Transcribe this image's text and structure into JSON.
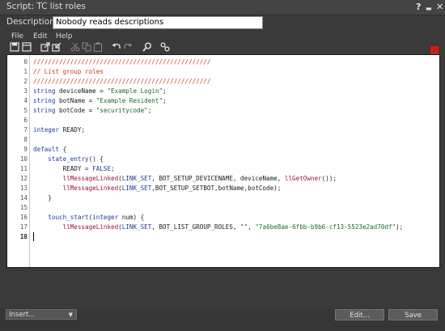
{
  "window": {
    "title": "Script: TC list roles",
    "help_button": "?",
    "minimize_button": "▬",
    "close_button": "✕"
  },
  "description": {
    "label": "Description:",
    "value": "Nobody reads descriptions"
  },
  "menubar": {
    "items": [
      "File",
      "Edit",
      "Help"
    ]
  },
  "toolbar": {
    "icons": [
      "save-icon",
      "save-all-icon",
      "load-icon",
      "save-to-disk-icon",
      "cut-icon",
      "copy-icon",
      "paste-icon",
      "undo-icon",
      "redo-icon",
      "search-icon",
      "settings-icon"
    ],
    "stop_color": "#c0251d"
  },
  "editor": {
    "current_line": "18",
    "lines": [
      {
        "num": "0",
        "segments": [
          {
            "t": "////////////////////////////////////////////////",
            "c": "cmt"
          }
        ]
      },
      {
        "num": "1",
        "segments": [
          {
            "t": "// List group roles",
            "c": "cmt"
          }
        ]
      },
      {
        "num": "2",
        "segments": [
          {
            "t": "////////////////////////////////////////////////",
            "c": "cmt"
          }
        ]
      },
      {
        "num": "3",
        "segments": [
          {
            "t": "string",
            "c": "kw"
          },
          {
            "t": " deviceName = ",
            "c": "txt"
          },
          {
            "t": "\"Example Login\"",
            "c": "str"
          },
          {
            "t": ";",
            "c": "txt"
          }
        ]
      },
      {
        "num": "4",
        "segments": [
          {
            "t": "string",
            "c": "kw"
          },
          {
            "t": " botName = ",
            "c": "txt"
          },
          {
            "t": "\"Example Resident\"",
            "c": "str"
          },
          {
            "t": ";",
            "c": "txt"
          }
        ]
      },
      {
        "num": "5",
        "segments": [
          {
            "t": "string",
            "c": "kw"
          },
          {
            "t": " botCode = ",
            "c": "txt"
          },
          {
            "t": "\"securitycode\"",
            "c": "str"
          },
          {
            "t": ";",
            "c": "txt"
          }
        ]
      },
      {
        "num": "6",
        "segments": []
      },
      {
        "num": "7",
        "segments": [
          {
            "t": "integer",
            "c": "kw"
          },
          {
            "t": " READY;",
            "c": "txt"
          }
        ]
      },
      {
        "num": "8",
        "segments": []
      },
      {
        "num": "9",
        "segments": [
          {
            "t": "default",
            "c": "kw"
          },
          {
            "t": " {",
            "c": "txt"
          }
        ]
      },
      {
        "num": "10",
        "segments": [
          {
            "t": "    ",
            "c": "txt"
          },
          {
            "t": "state_entry",
            "c": "kw"
          },
          {
            "t": "() {",
            "c": "txt"
          }
        ]
      },
      {
        "num": "11",
        "segments": [
          {
            "t": "        READY = ",
            "c": "txt"
          },
          {
            "t": "FALSE",
            "c": "const"
          },
          {
            "t": ";",
            "c": "txt"
          }
        ]
      },
      {
        "num": "12",
        "segments": [
          {
            "t": "        ",
            "c": "txt"
          },
          {
            "t": "llMessageLinked",
            "c": "fn"
          },
          {
            "t": "(",
            "c": "txt"
          },
          {
            "t": "LINK_SET",
            "c": "const"
          },
          {
            "t": ", BOT_SETUP_DEVICENAME, deviceName, ",
            "c": "txt"
          },
          {
            "t": "llGetOwner",
            "c": "fn"
          },
          {
            "t": "());",
            "c": "txt"
          }
        ]
      },
      {
        "num": "13",
        "segments": [
          {
            "t": "        ",
            "c": "txt"
          },
          {
            "t": "llMessageLinked",
            "c": "fn"
          },
          {
            "t": "(",
            "c": "txt"
          },
          {
            "t": "LINK_SET",
            "c": "const"
          },
          {
            "t": ",BOT_SETUP_SETBOT,botName,botCode);",
            "c": "txt"
          }
        ]
      },
      {
        "num": "14",
        "segments": [
          {
            "t": "    }",
            "c": "txt"
          }
        ]
      },
      {
        "num": "15",
        "segments": []
      },
      {
        "num": "16",
        "segments": [
          {
            "t": "    ",
            "c": "txt"
          },
          {
            "t": "touch_start",
            "c": "kw"
          },
          {
            "t": "(",
            "c": "txt"
          },
          {
            "t": "integer",
            "c": "kw"
          },
          {
            "t": " num) {",
            "c": "txt"
          }
        ]
      },
      {
        "num": "17",
        "segments": [
          {
            "t": "        ",
            "c": "txt"
          },
          {
            "t": "llMessageLinked",
            "c": "fn"
          },
          {
            "t": "(",
            "c": "txt"
          },
          {
            "t": "LINK_SET",
            "c": "const"
          },
          {
            "t": ", BOT_LIST_GROUP_ROLES, ",
            "c": "txt"
          },
          {
            "t": "\"\"",
            "c": "str"
          },
          {
            "t": ", ",
            "c": "txt"
          },
          {
            "t": "\"7a6be8ae-6fbb-b9b6-cf13-5523e2ad70df\"",
            "c": "str"
          },
          {
            "t": ");",
            "c": "txt"
          }
        ]
      },
      {
        "num": "18",
        "segments": []
      }
    ]
  },
  "footer": {
    "insert_label": "Insert...",
    "edit_label": "Edit...",
    "save_label": "Save"
  }
}
